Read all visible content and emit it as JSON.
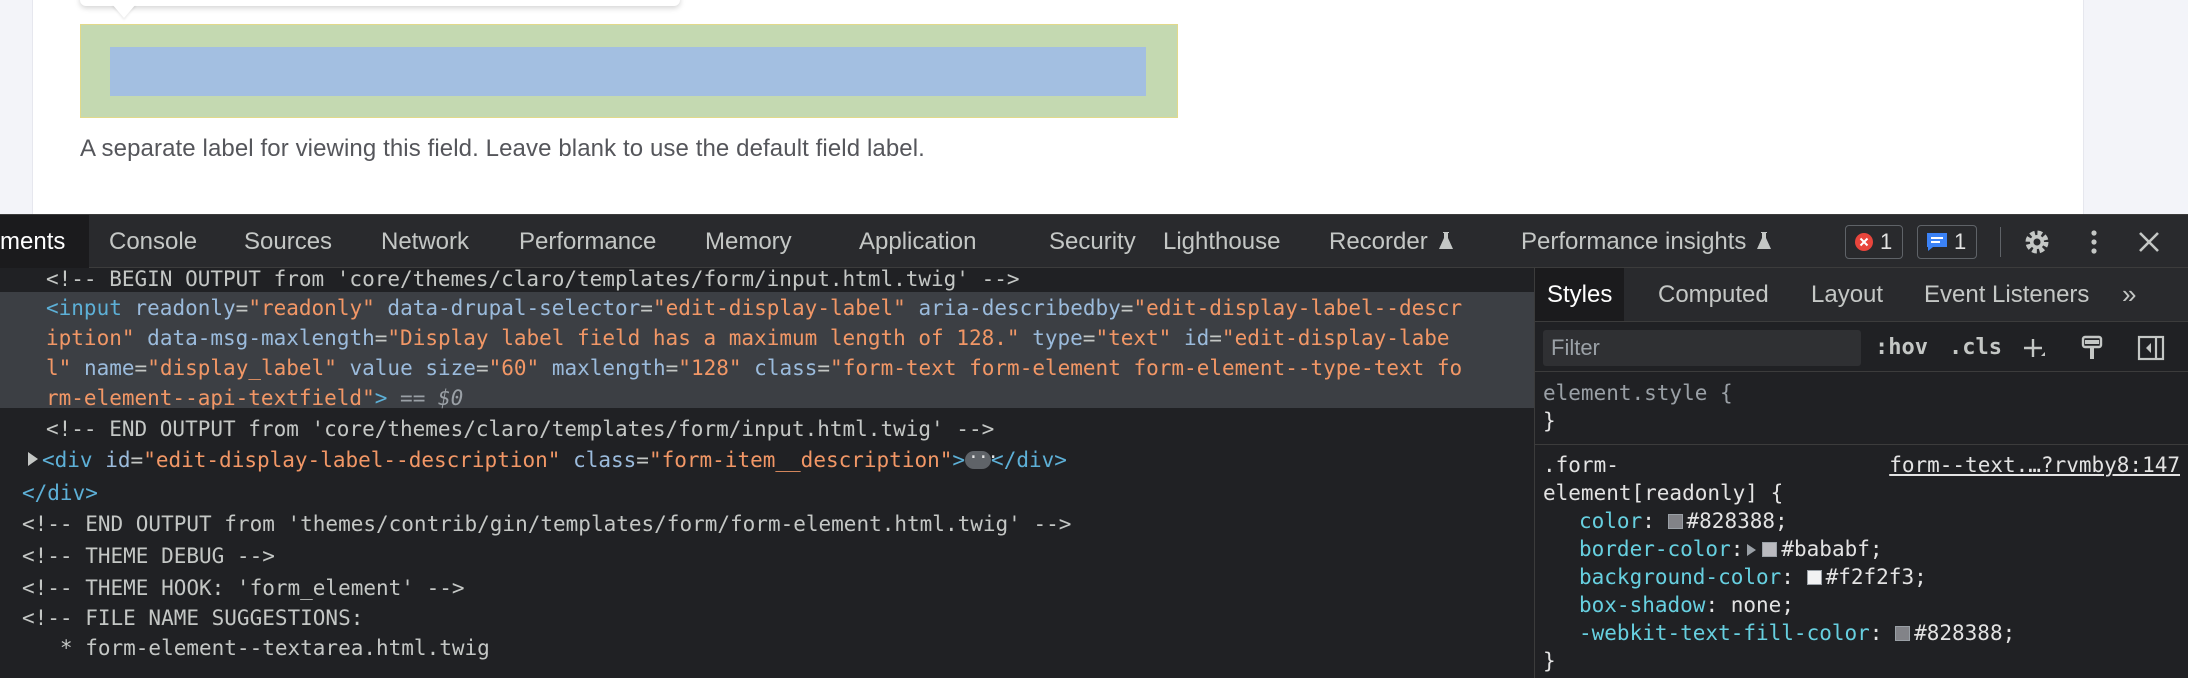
{
  "page": {
    "field_description": "A separate label for viewing this field. Leave blank to use the default field label."
  },
  "devtools": {
    "tabs": [
      {
        "label": "ments"
      },
      {
        "label": "Console"
      },
      {
        "label": "Sources"
      },
      {
        "label": "Network"
      },
      {
        "label": "Performance"
      },
      {
        "label": "Memory"
      },
      {
        "label": "Application"
      },
      {
        "label": "Security"
      },
      {
        "label": "Lighthouse"
      },
      {
        "label": "Recorder"
      },
      {
        "label": "Performance insights"
      }
    ],
    "error_count": "1",
    "message_count": "1",
    "colors": {
      "error": "#e8453c",
      "message": "#3b82f6",
      "attr": "#9bbbdc",
      "value": "#f29766",
      "tag": "#5db0d7"
    }
  },
  "dom": {
    "l1": "<!-- BEGIN OUTPUT from 'core/themes/claro/templates/form/input.html.twig' -->",
    "l2": {
      "open": "<input",
      "a1": "readonly",
      "v1": "\"readonly\"",
      "a2": "data-drupal-selector",
      "v2": "\"edit-display-label\"",
      "a3": "aria-describedby",
      "v3": "\"edit-display-label--descr"
    },
    "l3": {
      "v3b": "iption\"",
      "a4": "data-msg-maxlength",
      "v4": "\"Display label field has a maximum length of 128.\"",
      "a5": "type",
      "v5": "\"text\"",
      "a6": "id",
      "v6": "\"edit-display-labe"
    },
    "l4": {
      "v6b": "l\"",
      "a7": "name",
      "v7": "\"display_label\"",
      "a8": "value",
      "a9": "size",
      "v9": "\"60\"",
      "a10": "maxlength",
      "v10": "\"128\"",
      "a11": "class",
      "v11": "\"form-text form-element form-element--type-text fo"
    },
    "l5": {
      "v11b": "rm-element--api-textfield\"",
      "close": ">",
      "marker": "== $0"
    },
    "l6": "<!-- END OUTPUT from 'core/themes/claro/templates/form/input.html.twig' -->",
    "l7": {
      "open": "<div",
      "a1": "id",
      "v1": "\"edit-display-label--description\"",
      "a2": "class",
      "v2": "\"form-item__description\"",
      "close1": ">",
      "close2": "</div>"
    },
    "l8": "</div>",
    "l9": "<!-- END OUTPUT from 'themes/contrib/gin/templates/form/form-element.html.twig' -->",
    "l10": "<!-- THEME DEBUG -->",
    "l11": "<!-- THEME HOOK: 'form_element' -->",
    "l12": "<!-- FILE NAME SUGGESTIONS:",
    "l13": "   * form-element--textarea.html.twig"
  },
  "styles_panel": {
    "tabs": [
      {
        "label": "Styles"
      },
      {
        "label": "Computed"
      },
      {
        "label": "Layout"
      },
      {
        "label": "Event Listeners"
      },
      {
        "label": "»"
      }
    ],
    "filter_placeholder": "Filter",
    "hov": ":hov",
    "cls": ".cls",
    "element_style_selector": "element.style {",
    "brace_close": "}",
    "rule_selector_1": ".form-",
    "rule_selector_2": "element[readonly] {",
    "rule_source": "form--text.…?rvmby8:147",
    "props": [
      {
        "name": "color",
        "value": "#828388",
        "swatch": "#828388"
      },
      {
        "name": "border-color",
        "value": "#bababf",
        "swatch": "#bababf"
      },
      {
        "name": "background-color",
        "value": "#f2f2f3",
        "swatch": "#f2f2f3"
      },
      {
        "name": "box-shadow",
        "value": "none"
      },
      {
        "name": "-webkit-text-fill-color",
        "value": "#828388",
        "swatch": "#828388"
      }
    ]
  }
}
